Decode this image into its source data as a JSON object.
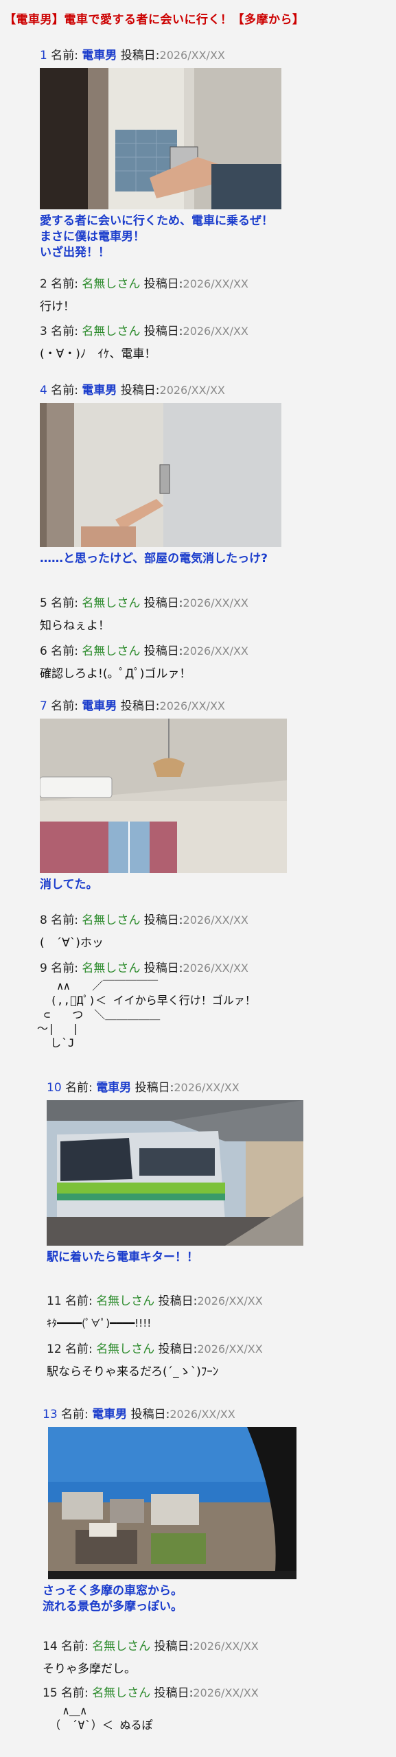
{
  "thread": {
    "title": "【電車男】電車で愛する者に会いに行く！【多摩から】"
  },
  "labels": {
    "name_prefix": "名前:",
    "date_prefix": "投稿日:"
  },
  "posts": [
    {
      "num": "1",
      "name": "電車男",
      "date": "2026/XX/XX",
      "body": "愛する者に会いに行くため、電車に乗るぜ！\nまさに僕は電車男！\nいざ出発！！"
    },
    {
      "num": "2",
      "name": "名無しさん",
      "date": "2026/XX/XX",
      "body": "行け！"
    },
    {
      "num": "3",
      "name": "名無しさん",
      "date": "2026/XX/XX",
      "body": "(・∀・)ﾉ　ｲｹ、電車！"
    },
    {
      "num": "4",
      "name": "電車男",
      "date": "2026/XX/XX",
      "body": "……と思ったけど、部屋の電気消したっけ?"
    },
    {
      "num": "5",
      "name": "名無しさん",
      "date": "2026/XX/XX",
      "body": "知らねぇよ！"
    },
    {
      "num": "6",
      "name": "名無しさん",
      "date": "2026/XX/XX",
      "body": "確認しろよ!(。ﾟДﾟ)ゴルァ！"
    },
    {
      "num": "7",
      "name": "電車男",
      "date": "2026/XX/XX",
      "body": "消してた。"
    },
    {
      "num": "8",
      "name": "名無しさん",
      "date": "2026/XX/XX",
      "body": "(　´∀`)ホッ"
    },
    {
      "num": "9",
      "name": "名無しさん",
      "date": "2026/XX/XX",
      "body": "   ∧∧　　／￣￣￣￣￣\n  (,,ﾟДﾟ)＜ イイから早く行け！ゴルァ！\n ⊂　　つ　＼＿＿＿＿＿\n～|　 |\n  し`J"
    },
    {
      "num": "10",
      "name": "電車男",
      "date": "2026/XX/XX",
      "body": "駅に着いたら電車キター！！"
    },
    {
      "num": "11",
      "name": "名無しさん",
      "date": "2026/XX/XX",
      "body": "ｷﾀ━━━━(ﾟ∀ﾟ)━━━━!!!!"
    },
    {
      "num": "12",
      "name": "名無しさん",
      "date": "2026/XX/XX",
      "body": "駅ならそりゃ来るだろ(´_ゝ`)ﾌｰﾝ"
    },
    {
      "num": "13",
      "name": "電車男",
      "date": "2026/XX/XX",
      "body": "さっそく多摩の車窓から。\n流れる景色が多摩っぽい。"
    },
    {
      "num": "14",
      "name": "名無しさん",
      "date": "2026/XX/XX",
      "body": "そりゃ多摩だし。"
    },
    {
      "num": "15",
      "name": "名無しさん",
      "date": "2026/XX/XX",
      "body": "  ∧＿∧\n（　´∀`）＜ ぬるぽ"
    }
  ]
}
